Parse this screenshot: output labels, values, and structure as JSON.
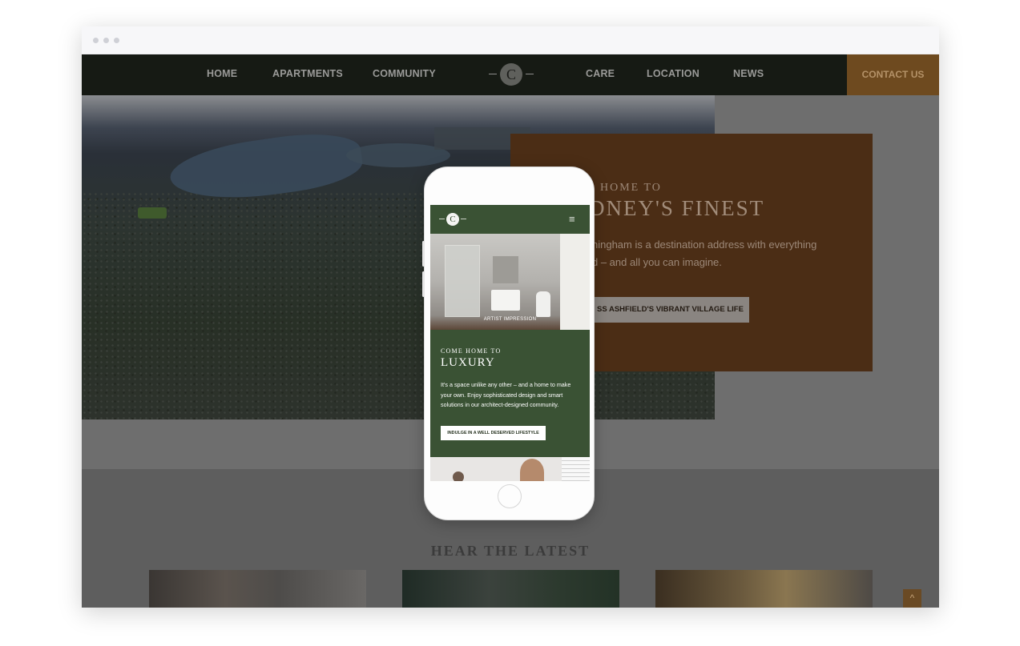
{
  "nav": {
    "links_left": [
      "HOME",
      "APARTMENTS",
      "COMMUNITY"
    ],
    "links_right": [
      "CARE",
      "LOCATION",
      "NEWS"
    ],
    "logo_letter": "C",
    "contact_label": "CONTACT US"
  },
  "hero": {
    "eyebrow": "HOME TO",
    "title": "DNEY'S FINEST",
    "paragraph_line1": "ningham is a destination address with everything",
    "paragraph_line2": "d – and all you can imagine.",
    "button_label": "SS ASHFIELD'S VIBRANT VILLAGE LIFE"
  },
  "latest": {
    "heading": "HEAR THE LATEST"
  },
  "scroll_top_icon": "^",
  "mobile": {
    "logo_letter": "C",
    "menu_icon": "≡",
    "photo_caption": "ARTIST IMPRESSION",
    "eyebrow": "COME HOME TO",
    "title": "LUXURY",
    "paragraph": "It's a space unlike any other – and a home to make your own. Enjoy sophisticated design and smart solutions in our architect-designed community.",
    "button_label": "INDULGE IN A WELL DESERVED LIFESTYLE"
  },
  "colors": {
    "nav_bg": "#161a14",
    "contact_bg": "#6e4a1f",
    "hero_card_bg": "#4b2d15",
    "mobile_green": "#3a5234"
  }
}
